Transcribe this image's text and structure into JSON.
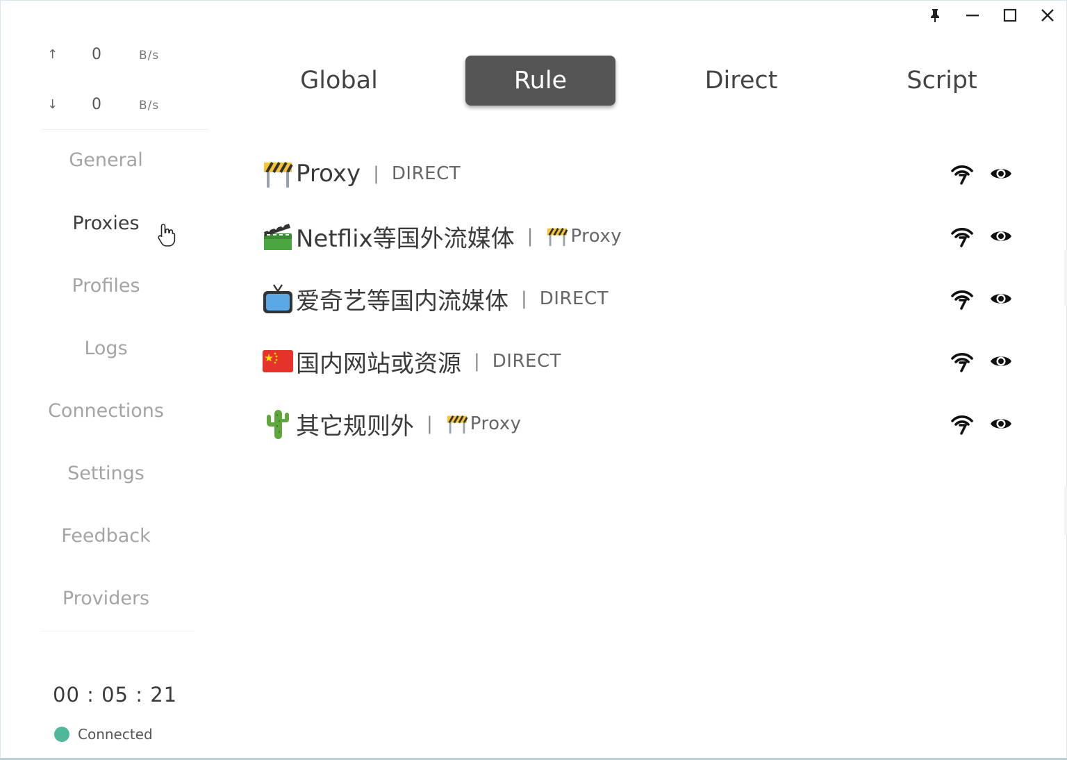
{
  "window_controls": {
    "pin_icon": "pin-icon",
    "minimize_icon": "minimize-icon",
    "maximize_icon": "maximize-icon",
    "close_icon": "close-icon"
  },
  "traffic": {
    "upload": {
      "arrow": "↑",
      "value": "0",
      "unit": "B/s"
    },
    "download": {
      "arrow": "↓",
      "value": "0",
      "unit": "B/s"
    }
  },
  "nav": {
    "items": [
      {
        "label": "General",
        "active": false
      },
      {
        "label": "Proxies",
        "active": true
      },
      {
        "label": "Profiles",
        "active": false
      },
      {
        "label": "Logs",
        "active": false
      },
      {
        "label": "Connections",
        "active": false
      },
      {
        "label": "Settings",
        "active": false
      },
      {
        "label": "Feedback",
        "active": false
      },
      {
        "label": "Providers",
        "active": false
      }
    ]
  },
  "footer": {
    "timer": "00 : 05 : 21",
    "status": "Connected",
    "status_color": "#4fb79a"
  },
  "modes": {
    "tabs": [
      {
        "label": "Global",
        "active": false
      },
      {
        "label": "Rule",
        "active": true
      },
      {
        "label": "Direct",
        "active": false
      },
      {
        "label": "Script",
        "active": false
      }
    ],
    "active_color": "#555555"
  },
  "groups": [
    {
      "icon": "construction-barrier-icon",
      "name": "Proxy",
      "separator": "|",
      "now_icon": "",
      "now": "DIRECT"
    },
    {
      "icon": "clapperboard-icon",
      "name": "Netflix等国外流媒体",
      "separator": "|",
      "now_icon": "construction-barrier-icon",
      "now": "Proxy"
    },
    {
      "icon": "television-icon",
      "name": "爱奇艺等国内流媒体",
      "separator": "|",
      "now_icon": "",
      "now": "DIRECT"
    },
    {
      "icon": "china-flag-icon",
      "name": "国内网站或资源",
      "separator": "|",
      "now_icon": "",
      "now": "DIRECT"
    },
    {
      "icon": "cactus-icon",
      "name": "其它规则外",
      "separator": "|",
      "now_icon": "construction-barrier-icon",
      "now": "Proxy"
    }
  ],
  "group_actions": {
    "latency_icon": "wifi-latency-icon",
    "view_icon": "eye-icon"
  }
}
